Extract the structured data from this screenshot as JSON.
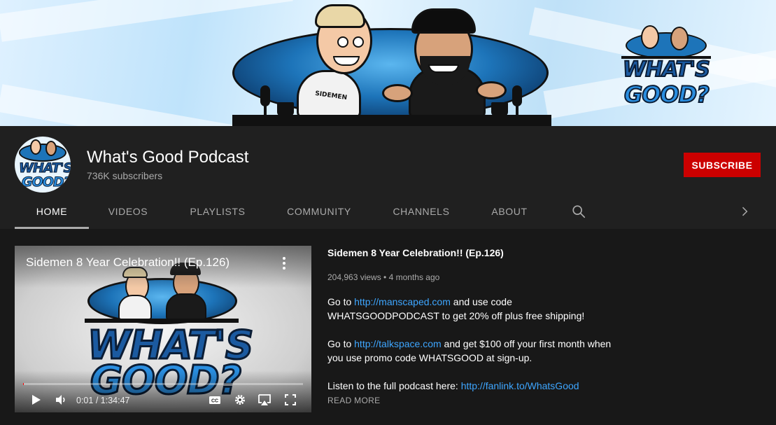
{
  "banner": {
    "logo_line1": "WHAT'S",
    "logo_line2": "GOOD?",
    "shirt_text": "SIDEMEN"
  },
  "channel": {
    "title": "What's Good Podcast",
    "subscribers": "736K subscribers",
    "subscribe_label": "SUBSCRIBE",
    "avatar_line1": "WHAT'S",
    "avatar_line2": "GOOD?"
  },
  "tabs": [
    {
      "label": "HOME",
      "active": true
    },
    {
      "label": "VIDEOS"
    },
    {
      "label": "PLAYLISTS"
    },
    {
      "label": "COMMUNITY"
    },
    {
      "label": "CHANNELS"
    },
    {
      "label": "ABOUT"
    }
  ],
  "icons": {
    "search": "search-icon",
    "next": "chevron-right-icon",
    "more": "more-vert-icon",
    "play": "play-icon",
    "volume": "volume-icon",
    "cc": "closed-captions-icon",
    "settings": "gear-icon",
    "airplay": "airplay-icon",
    "fullscreen": "fullscreen-icon"
  },
  "colors": {
    "accent_red": "#cc0000",
    "link_blue": "#3ea6ff"
  },
  "featured_video": {
    "player_title": "Sidemen 8 Year Celebration!! (Ep.126)",
    "logo_line1": "WHAT'S",
    "logo_line2": "GOOD?",
    "current_time": "0:01",
    "duration": "1:34:47",
    "time_separator": " / ",
    "progress": 0.002,
    "title": "Sidemen 8 Year Celebration!! (Ep.126)",
    "views": "204,963 views",
    "age": "4 months ago",
    "meta_separator": " • ",
    "description": [
      {
        "before": "Go to ",
        "link": "http://manscaped.com",
        "after": " and use code WHATSGOODPODCAST to get 20% off plus free shipping!"
      },
      {
        "before": "Go to ",
        "link": "http://talkspace.com",
        "after": " and get $100 off your first month when you use promo code WHATSGOOD at sign-up."
      },
      {
        "before": "Listen to the full podcast here: ",
        "link": "http://fanlink.to/WhatsGood",
        "after": ""
      }
    ],
    "read_more": "READ MORE"
  }
}
